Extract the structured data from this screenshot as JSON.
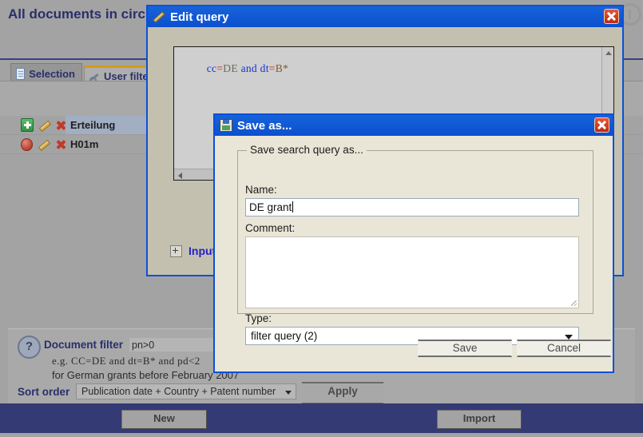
{
  "page": {
    "title": "All documents in circ"
  },
  "tabs": [
    {
      "label": "Selection",
      "icon": "document-icon",
      "selected": true
    },
    {
      "label": "User filte",
      "icon": "wrench-icon",
      "selected": false
    }
  ],
  "list_rows": [
    {
      "label": "Erteilung",
      "status_icon": "green-plus-icon",
      "highlight": true
    },
    {
      "label": "H01m",
      "status_icon": "red-stop-icon",
      "highlight": false
    }
  ],
  "row_actions": {
    "edit": "pencil-icon",
    "delete": "red-x-icon"
  },
  "filter_panel": {
    "help_icon": "question-mark-icon",
    "document_filter_label": "Document filter",
    "document_filter_value": "pn>0",
    "hint_line1": "e.g. CC=DE and dt=B* and pd<2",
    "hint_line2": "for German grants before February 2007",
    "sort_order_label": "Sort order",
    "sort_order_value": "Publication date + Country + Patent number",
    "apply_label": "Apply"
  },
  "bottom_bar": {
    "new_label": "New",
    "import_label": "Import"
  },
  "edit_query_dialog": {
    "title": "Edit query",
    "title_icon": "pencil-icon",
    "close_icon": "close-icon",
    "query_tokens": [
      {
        "text": "cc",
        "type": "field"
      },
      {
        "text": "=",
        "type": "op"
      },
      {
        "text": "DE",
        "type": "value"
      },
      {
        "text": " ",
        "type": "plain"
      },
      {
        "text": "and",
        "type": "and"
      },
      {
        "text": " ",
        "type": "plain"
      },
      {
        "text": "dt",
        "type": "field"
      },
      {
        "text": "=",
        "type": "op"
      },
      {
        "text": "B*",
        "type": "value2"
      }
    ],
    "query_text": "cc=DE and dt=B*",
    "input_section_label": "Input",
    "expand_icon": "expand-plus-icon"
  },
  "save_as_dialog": {
    "title": "Save as...",
    "title_icon": "floppy-disk-icon",
    "close_icon": "close-icon",
    "group_legend": "Save search query as...",
    "name_label": "Name:",
    "name_value": "DE grant",
    "comment_label": "Comment:",
    "comment_value": "",
    "type_label": "Type:",
    "type_value": "filter query (2)",
    "save_label": "Save",
    "cancel_label": "Cancel"
  },
  "colors": {
    "title_bar_blue": "#0b4fd0",
    "dialog_border_blue": "#0a50d8",
    "dialog_face": "#eae6d7",
    "edit_dialog_face": "#c4c0b0",
    "app_background": "#a3a3a3",
    "bottom_bar": "#343a73",
    "heading_navy": "#2a2f6b",
    "close_red": "#bd2a14"
  }
}
